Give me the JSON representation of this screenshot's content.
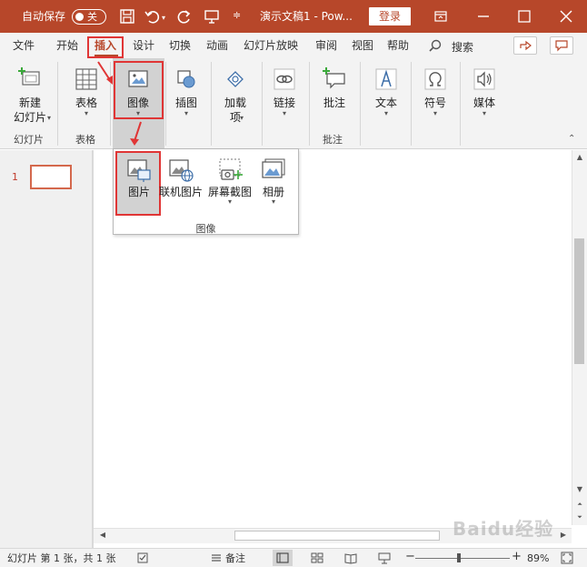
{
  "colors": {
    "accent": "#b7472a",
    "highlight_box": "#e03535",
    "ribbon_bg": "#f3f3f3"
  },
  "titlebar": {
    "autosave_label": "自动保存",
    "autosave_state": "关",
    "document_title": "演示文稿1 - Pow...",
    "login_label": "登录",
    "icons": [
      "save-icon",
      "undo-icon",
      "redo-icon",
      "present-icon",
      "customize-qat-icon",
      "ribbon-display-icon",
      "minimize-icon",
      "maximize-icon",
      "close-icon"
    ]
  },
  "tabs": [
    {
      "label": "文件"
    },
    {
      "label": "开始"
    },
    {
      "label": "插入",
      "active": true
    },
    {
      "label": "设计"
    },
    {
      "label": "切换"
    },
    {
      "label": "动画"
    },
    {
      "label": "幻灯片放映"
    },
    {
      "label": "审阅"
    },
    {
      "label": "视图"
    },
    {
      "label": "帮助"
    }
  ],
  "search": {
    "label": "搜索"
  },
  "ribbon": {
    "new_slide": {
      "line1": "新建",
      "line2": "幻灯片"
    },
    "table": {
      "label": "表格"
    },
    "images": {
      "label": "图像"
    },
    "illustrations": {
      "label": "插图"
    },
    "addins": {
      "line1": "加载",
      "line2": "项"
    },
    "links": {
      "label": "链接"
    },
    "comment": {
      "label": "批注"
    },
    "text": {
      "label": "文本"
    },
    "symbols": {
      "label": "符号"
    },
    "media": {
      "label": "媒体"
    },
    "groups": {
      "slides": "幻灯片",
      "tables": "表格",
      "comments": "批注"
    }
  },
  "dropdown": {
    "items": [
      {
        "label": "图片",
        "selected": true
      },
      {
        "label": "联机图片"
      },
      {
        "label": "屏幕截图"
      },
      {
        "label": "相册"
      }
    ],
    "group_label": "图像"
  },
  "slides_pane": {
    "slide_number": "1"
  },
  "statusbar": {
    "slide_info": "幻灯片 第 1 张，共 1 张",
    "notes_label": "备注",
    "zoom_percent": "89%",
    "zoom_level": 0.89
  },
  "watermark": {
    "text": "Baidu经验"
  }
}
